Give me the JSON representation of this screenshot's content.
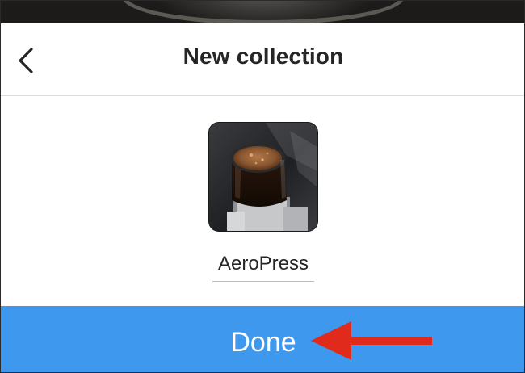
{
  "header": {
    "title": "New collection",
    "back_icon": "chevron-left-icon"
  },
  "collection": {
    "cover_image": "aeropress-coffee-photo",
    "name_value": "AeroPress"
  },
  "footer": {
    "done_label": "Done"
  },
  "annotation": {
    "arrow_color": "#e02a1b",
    "arrow_icon": "left-arrow-icon"
  },
  "colors": {
    "accent": "#3d98ee",
    "text": "#262626"
  }
}
